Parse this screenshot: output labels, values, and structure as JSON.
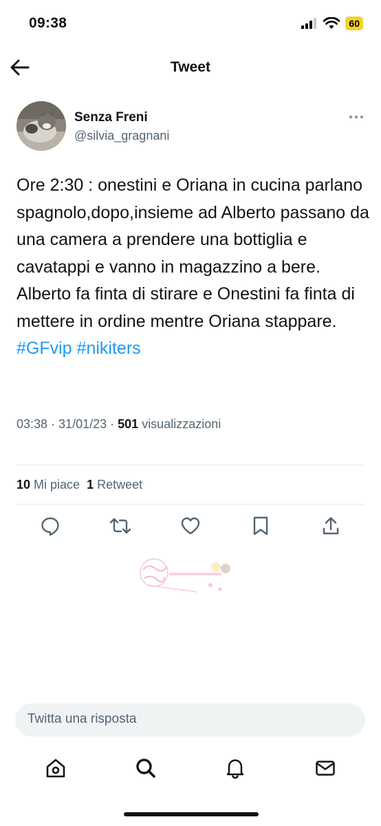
{
  "status_bar": {
    "time": "09:38",
    "battery": "60",
    "battery_color": "#f2d230",
    "icons": [
      "signal-icon",
      "wifi-icon",
      "battery-icon"
    ]
  },
  "header": {
    "title": "Tweet",
    "back_icon": "arrow-left-icon"
  },
  "author": {
    "name": "Senza Freni",
    "handle": "@silvia_gragnani"
  },
  "tweet": {
    "text": "Ore 2:30 : onestini e Oriana in cucina parlano spagnolo,dopo,insieme ad Alberto passano da una camera a prendere una bottiglia e cavatappi e vanno in magazzino a bere. Alberto fa finta di stirare e Onestini fa finta di mettere in ordine mentre Oriana stappare.",
    "hashtags": [
      "#GFvip",
      "#nikiters"
    ],
    "time": "03:38",
    "date": "31/01/23",
    "views_count": "501",
    "views_label": "visualizzazioni",
    "link_color": "#1d9bf0"
  },
  "stats": {
    "likes_count": "10",
    "likes_label": "Mi piace",
    "retweets_count": "1",
    "retweets_label": "Retweet"
  },
  "actions": [
    "reply-icon",
    "retweet-icon",
    "like-icon",
    "bookmark-icon",
    "share-icon"
  ],
  "reply": {
    "placeholder": "Twitta una risposta"
  },
  "tabbar": [
    "home-icon",
    "search-icon",
    "notifications-icon",
    "messages-icon"
  ]
}
